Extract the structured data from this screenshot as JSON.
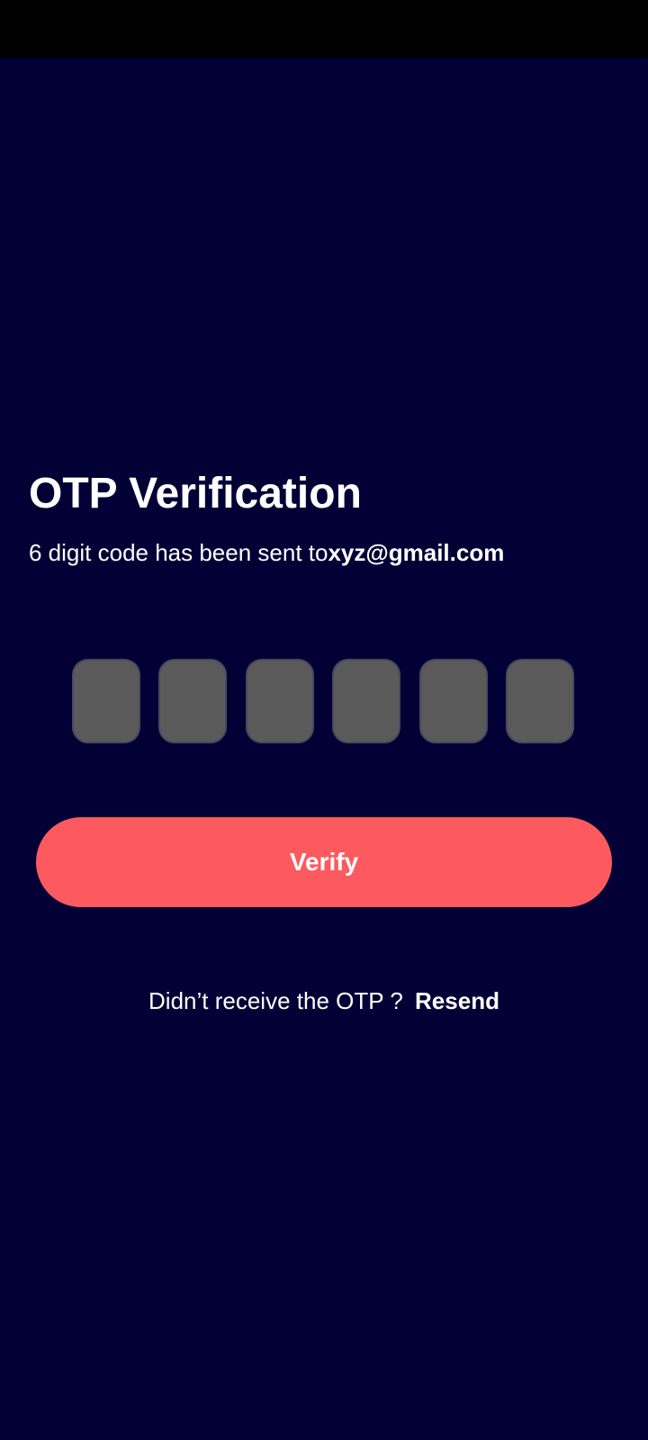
{
  "otp_screen": {
    "title": "OTP Verification",
    "subtitle_prefix": "6 digit code has been sent to",
    "email": "xyz@gmail.com",
    "otp_digits": [
      "",
      "",
      "",
      "",
      "",
      ""
    ],
    "verify_label": "Verify",
    "resend_prompt": "Didn’t receive the OTP ?",
    "resend_label": "Resend"
  },
  "colors": {
    "background": "#020035",
    "status_bar": "#000000",
    "otp_box_fill": "#5a5a5a",
    "accent_button": "#fc5a5f",
    "text": "#ffffff"
  }
}
